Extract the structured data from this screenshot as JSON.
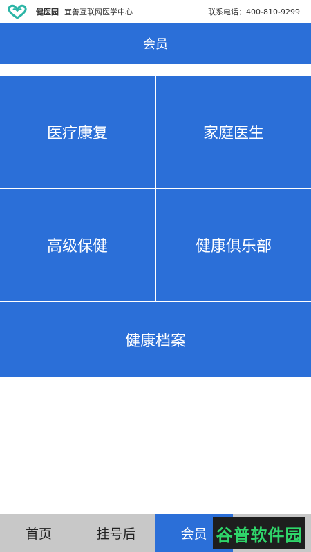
{
  "header": {
    "brand": "健医园",
    "subtitle": "宜善互联网医学中心",
    "hotline": "联系电话：400-810-9299",
    "logo_icon": "heart-logo-icon"
  },
  "title": "会员",
  "tiles": [
    {
      "label": "医疗康复"
    },
    {
      "label": "家庭医生"
    },
    {
      "label": "高级保健"
    },
    {
      "label": "健康俱乐部"
    },
    {
      "label": "健康档案"
    }
  ],
  "bottom_nav": {
    "items": [
      {
        "label": "首页"
      },
      {
        "label": "挂号后"
      },
      {
        "label": "会员"
      },
      {
        "label": ""
      }
    ],
    "active_index": 2
  },
  "watermark": "谷普软件园",
  "colors": {
    "primary": "#2b6fd8",
    "nav_bg": "#c8c8c8",
    "logo": "#2bb5a6"
  }
}
